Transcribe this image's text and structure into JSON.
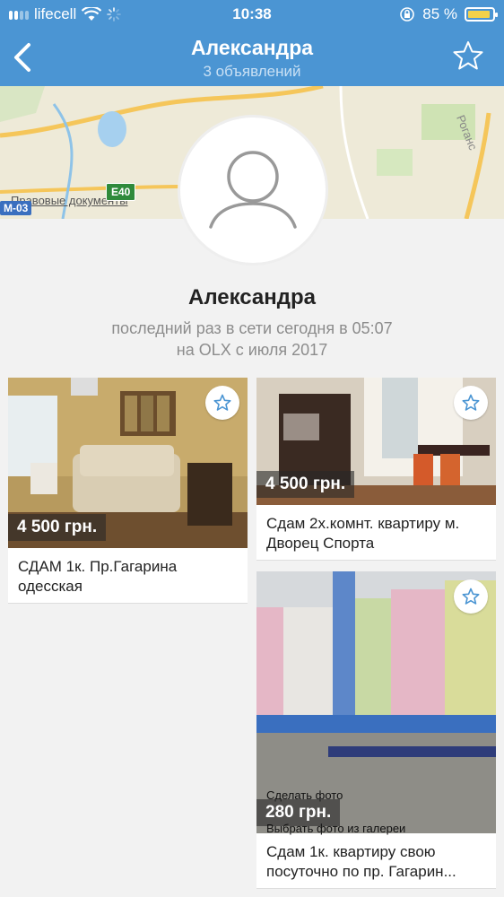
{
  "status_bar": {
    "carrier": "lifecell",
    "time": "10:38",
    "battery": "85 %",
    "battery_level": 0.85
  },
  "nav": {
    "title": "Александра",
    "subtitle": "3 объявлений"
  },
  "map": {
    "link": "Правовые документы",
    "road_label": "M-03",
    "highway_label": "E40",
    "street_label": "Роганс"
  },
  "profile": {
    "name": "Александра",
    "last_seen": "последний раз в сети сегодня в 05:07",
    "member_since": "на OLX с июля 2017"
  },
  "listings": [
    {
      "price": "4 500 грн.",
      "title_line1": "СДАМ 1к. Пр.Гагарина",
      "title_line2": "одесская"
    },
    {
      "price": "4 500 грн.",
      "title_line1": "Сдам 2х.комнт. квартиру м.",
      "title_line2": "Дворец Спорта"
    },
    {
      "price": "280 грн.",
      "title_line1": "Сдам 1к. квартиру свою",
      "title_line2": "посуточно по пр. Гагарин...",
      "overlay_top": "Сделать фото",
      "overlay_bottom": "Выбрать фото из галереи"
    }
  ],
  "colors": {
    "header": "#4b95d3",
    "background": "#f2f2f2",
    "favorite_star": "#4b95d3"
  },
  "icons": {
    "back": "back-chevron-icon",
    "favorite": "star-outline-icon",
    "avatar": "user-placeholder-icon"
  }
}
